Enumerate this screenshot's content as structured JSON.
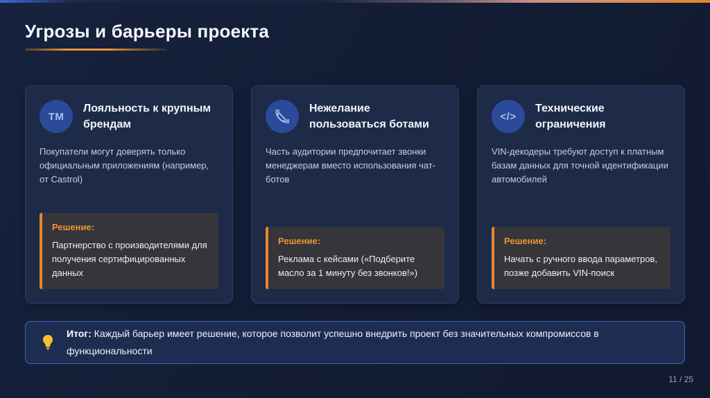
{
  "slide": {
    "title": "Угрозы и барьеры проекта",
    "page_number": "11 / 25"
  },
  "cards": [
    {
      "icon_text": "TM",
      "icon_name": "trademark-icon",
      "title": "Лояльность к крупным брендам",
      "description": "Покупатели могут доверять только официальным приложениям (например, от Castrol)",
      "solution_label": "Решение:",
      "solution_text": "Партнерство с производителями для получения сертифицированных данных"
    },
    {
      "icon_text": "",
      "icon_name": "phone-slash-icon",
      "title": "Нежелание пользоваться ботами",
      "description": "Часть аудитории предпочитает звонки менеджерам вместо использования чат-ботов",
      "solution_label": "Решение:",
      "solution_text": "Реклама с кейсами («Подберите масло за 1 минуту без звонков!»)"
    },
    {
      "icon_text": "</>",
      "icon_name": "code-icon",
      "title": "Технические ограничения",
      "description": "VIN-декодеры требуют доступ к платным базам данных для точной идентификации автомобилей",
      "solution_label": "Решение:",
      "solution_text": "Начать с ручного ввода параметров, позже добавить VIN-поиск"
    }
  ],
  "summary": {
    "label": "Итог:",
    "text": "Каждый барьер имеет решение, которое позволит успешно внедрить проект без значительных компромиссов в функциональности",
    "icon_name": "lightbulb-icon"
  },
  "colors": {
    "accent_orange": "#E8862E",
    "solution_label_orange": "#EE9530",
    "icon_circle_blue": "#2C4A9A",
    "icon_glyph_blue": "#A9C1EE",
    "card_background": "#1D2B48",
    "page_background": "#131D35",
    "summary_border_blue": "#3E66AE",
    "bulb_yellow": "#F2C230"
  }
}
